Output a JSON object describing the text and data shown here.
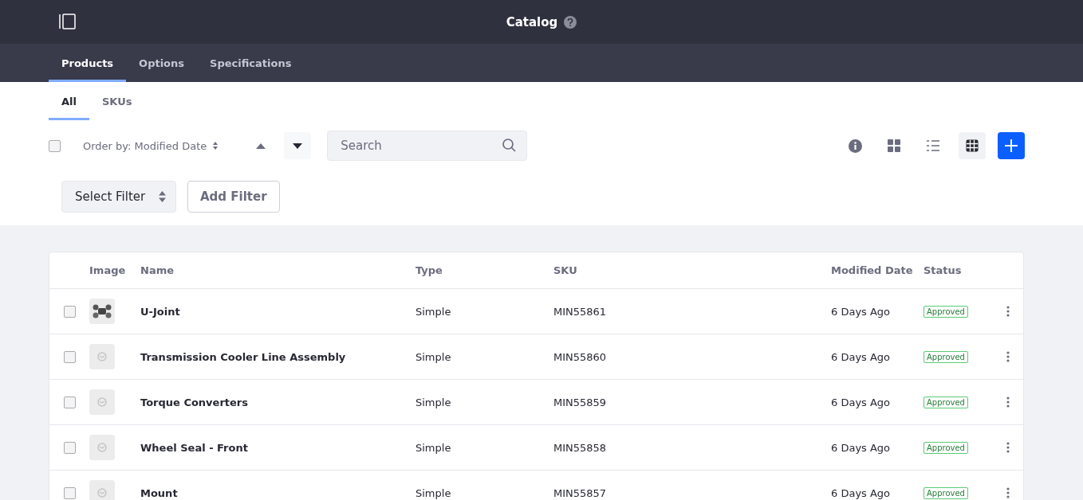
{
  "header": {
    "title": "Catalog"
  },
  "nav_tabs": [
    {
      "label": "Products",
      "selected": true
    },
    {
      "label": "Options",
      "selected": false
    },
    {
      "label": "Specifications",
      "selected": false
    }
  ],
  "sub_tabs": [
    {
      "label": "All",
      "selected": true
    },
    {
      "label": "SKUs",
      "selected": false
    }
  ],
  "toolbar": {
    "select_all_checked": false,
    "order_by": "Order by: Modified Date",
    "search": {
      "placeholder": "Search"
    },
    "views": [
      {
        "kind": "cards",
        "selected": false
      },
      {
        "kind": "list",
        "selected": false
      },
      {
        "kind": "table",
        "selected": true
      }
    ],
    "select_filter": "Select Filter",
    "add_filter": "Add Filter"
  },
  "table": {
    "columns": [
      "Image",
      "Name",
      "Type",
      "SKU",
      "Modified Date",
      "Status"
    ],
    "rows": [
      {
        "checked": false,
        "kind": "photo",
        "name": "U-Joint",
        "type": "Simple",
        "sku": "MIN55861",
        "modified": "6 Days Ago",
        "status": "Approved"
      },
      {
        "checked": false,
        "kind": "placeholder",
        "name": "Transmission Cooler Line Assembly",
        "type": "Simple",
        "sku": "MIN55860",
        "modified": "6 Days Ago",
        "status": "Approved"
      },
      {
        "checked": false,
        "kind": "placeholder",
        "name": "Torque Converters",
        "type": "Simple",
        "sku": "MIN55859",
        "modified": "6 Days Ago",
        "status": "Approved"
      },
      {
        "checked": false,
        "kind": "placeholder",
        "name": "Wheel Seal - Front",
        "type": "Simple",
        "sku": "MIN55858",
        "modified": "6 Days Ago",
        "status": "Approved"
      },
      {
        "checked": false,
        "kind": "placeholder",
        "name": "Mount",
        "type": "Simple",
        "sku": "MIN55857",
        "modified": "6 Days Ago",
        "status": "Approved"
      }
    ]
  }
}
